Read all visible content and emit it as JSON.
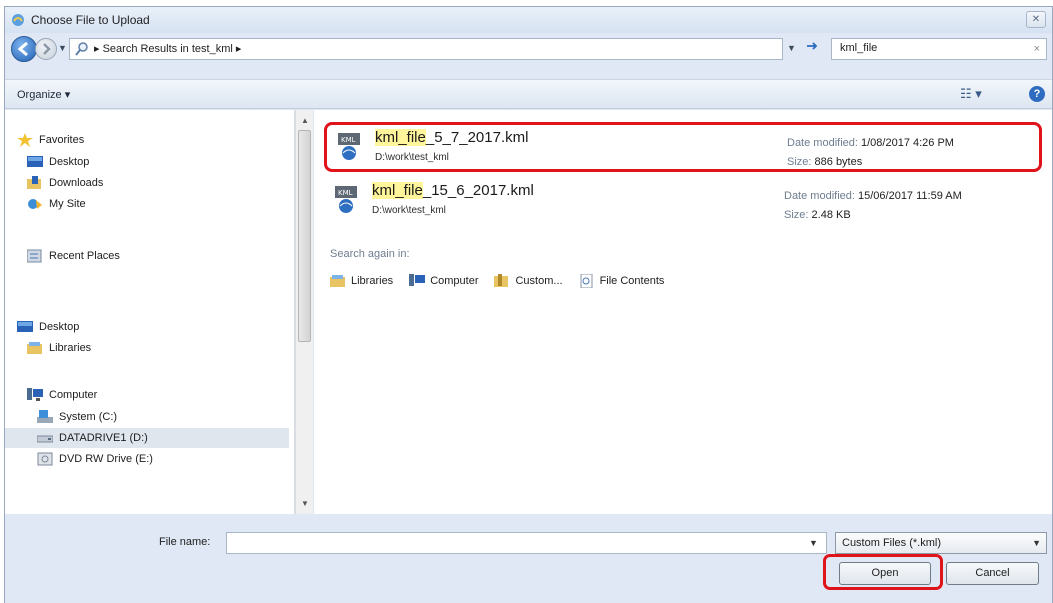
{
  "window": {
    "title": "Choose File to Upload",
    "close_label": "✕"
  },
  "nav": {
    "breadcrumb": "▸ Search Results in test_kml ▸",
    "search_value": "kml_file",
    "search_clear": "×"
  },
  "toolbar": {
    "organize_label": "Organize ▾",
    "views_label": "☷ ▾",
    "help_label": "?"
  },
  "sidebar": {
    "favorites": {
      "label": "Favorites",
      "items": [
        "Desktop",
        "Downloads",
        "My Site"
      ]
    },
    "recent": "Recent Places",
    "desktop": "Desktop",
    "libraries": "Libraries",
    "computer": {
      "label": "Computer",
      "items": [
        "System (C:)",
        "DATADRIVE1 (D:)",
        "DVD RW Drive (E:)"
      ],
      "selected_index": 1
    }
  },
  "results": {
    "files": [
      {
        "name_highlight": "kml_file",
        "name_rest": "_5_7_2017.kml",
        "path": "D:\\work\\test_kml",
        "date_label": "Date modified:",
        "date_value": "1/08/2017 4:26 PM",
        "size_label": "Size:",
        "size_value": "886 bytes",
        "highlighted": true
      },
      {
        "name_highlight": "kml_file",
        "name_rest": "_15_6_2017.kml",
        "path": "D:\\work\\test_kml",
        "date_label": "Date modified:",
        "date_value": "15/06/2017 11:59 AM",
        "size_label": "Size:",
        "size_value": "2.48 KB",
        "highlighted": false
      }
    ],
    "search_again_label": "Search again in:",
    "search_again": [
      "Libraries",
      "Computer",
      "Custom...",
      "File Contents"
    ]
  },
  "bottom": {
    "filename_label": "File name:",
    "filename_value": "",
    "filetype": "Custom Files (*.kml)",
    "open_label": "Open",
    "cancel_label": "Cancel"
  },
  "colors": {
    "accent": "#e0121a",
    "highlight": "#fff59a",
    "chrome": "#dfe8f4"
  }
}
